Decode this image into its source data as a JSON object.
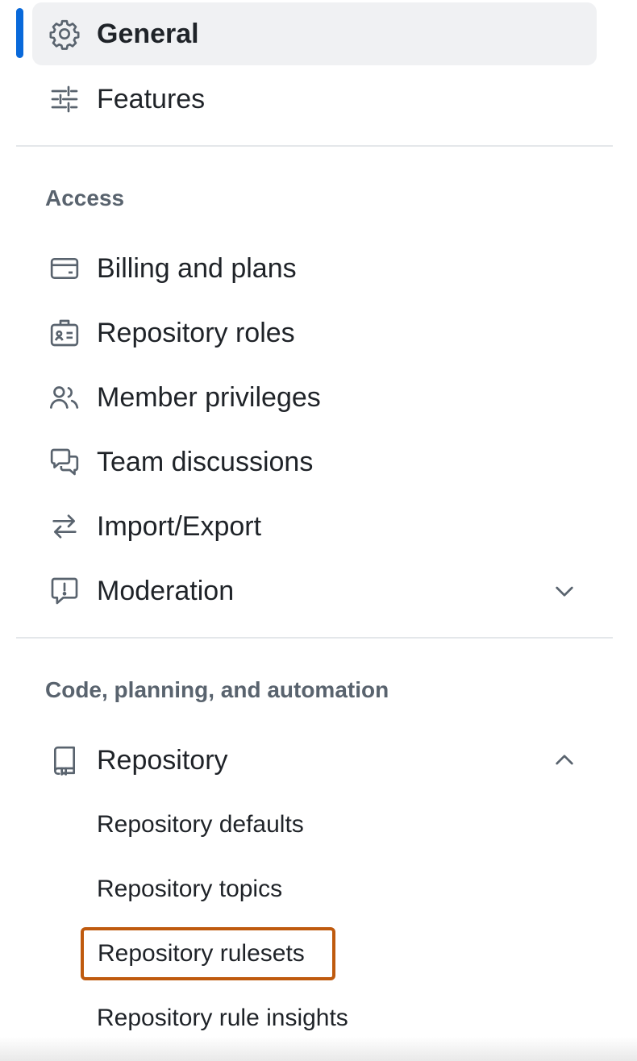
{
  "nav": {
    "top_items": [
      {
        "label": "General",
        "icon": "gear-icon",
        "selected": true
      },
      {
        "label": "Features",
        "icon": "sliders-icon",
        "selected": false
      }
    ],
    "access": {
      "heading": "Access",
      "items": [
        {
          "label": "Billing and plans",
          "icon": "credit-card-icon"
        },
        {
          "label": "Repository roles",
          "icon": "id-badge-icon"
        },
        {
          "label": "Member privileges",
          "icon": "people-icon"
        },
        {
          "label": "Team discussions",
          "icon": "comment-discussion-icon"
        },
        {
          "label": "Import/Export",
          "icon": "arrow-switch-icon"
        },
        {
          "label": "Moderation",
          "icon": "report-icon",
          "expandable": true,
          "expanded": false
        }
      ]
    },
    "code": {
      "heading": "Code, planning, and automation",
      "repository": {
        "label": "Repository",
        "icon": "repo-icon",
        "expanded": true
      },
      "sub_items": [
        {
          "label": "Repository defaults"
        },
        {
          "label": "Repository topics"
        },
        {
          "label": "Repository rulesets",
          "highlighted": true
        },
        {
          "label": "Repository rule insights"
        }
      ]
    }
  },
  "colors": {
    "selected_indicator": "#0969da",
    "highlight_border": "#bf5a0e",
    "selected_background": "#f0f1f3"
  }
}
